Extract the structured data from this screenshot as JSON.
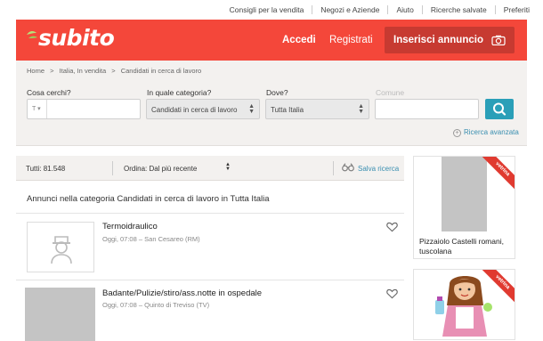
{
  "topbar": {
    "links": [
      "Consigli per la vendita",
      "Negozi e Aziende",
      "Aiuto",
      "Ricerche salvate",
      "Preferiti"
    ]
  },
  "header": {
    "logo": "subito",
    "accedi": "Accedi",
    "registrati": "Registrati",
    "insert": "Inserisci annuncio",
    "brand_color": "#f4473a"
  },
  "breadcrumb": [
    "Home",
    ">",
    "Italia, In vendita",
    ">",
    "Candidati in cerca di lavoro"
  ],
  "search": {
    "what_label": "Cosa cerchi?",
    "what_value": "",
    "category_label": "In quale categoria?",
    "category_value": "Candidati in cerca di lavoro",
    "where_label": "Dove?",
    "where_value": "Tutta Italia",
    "comune_label": "Comune",
    "comune_value": "",
    "advanced": "Ricerca avanzata",
    "button_color": "#2a9fb8"
  },
  "results": {
    "total": "Tutti: 81.548",
    "order": "Ordina: Dal più recente",
    "save_search": "Salva ricerca",
    "heading": "Annunci nella categoria Candidati in cerca di lavoro in Tutta Italia",
    "items": [
      {
        "title": "Termoidraulico",
        "date": "Oggi, 07:08",
        "location": "San Cesareo (RM)"
      },
      {
        "title": "Badante/Pulizie/stiro/ass.notte in ospedale",
        "date": "Oggi, 07:08",
        "location": "Quinto di Treviso (TV)"
      }
    ]
  },
  "sidebar": {
    "ads": [
      {
        "badge": "vetrina",
        "title": "Pizzaiolo Castelli romani, tuscolana"
      },
      {
        "badge": "vetrina",
        "title": ""
      }
    ]
  }
}
